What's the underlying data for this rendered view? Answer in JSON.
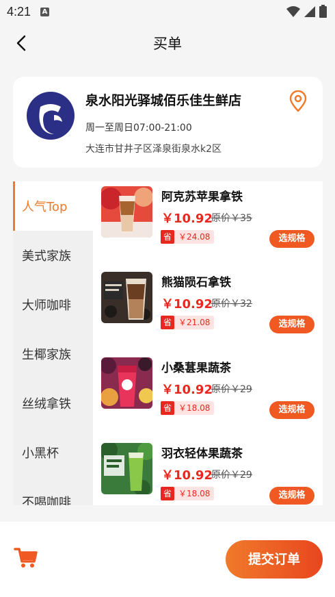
{
  "status_bar": {
    "time": "4:21",
    "notification_icon": "A"
  },
  "nav": {
    "title": "买单"
  },
  "store": {
    "name": "泉水阳光驿城佰乐佳生鲜店",
    "hours": "周一至周日07:00-21:00",
    "address": "大连市甘井子区泽泉街泉水k2区"
  },
  "categories": [
    {
      "label": "人气Top",
      "active": true
    },
    {
      "label": "美式家族"
    },
    {
      "label": "大师咖啡"
    },
    {
      "label": "生椰家族"
    },
    {
      "label": "丝绒拿铁"
    },
    {
      "label": "小黑杯"
    },
    {
      "label": "不喝咖啡"
    }
  ],
  "products": [
    {
      "name": "阿克苏苹果拿铁",
      "price": "￥10.92",
      "original": "原价￥35",
      "save_tag": "省",
      "save_amount": "￥24.08",
      "button": "选规格"
    },
    {
      "name": "熊猫陨石拿铁",
      "price": "￥10.92",
      "original": "原价￥32",
      "save_tag": "省",
      "save_amount": "￥21.08",
      "button": "选规格"
    },
    {
      "name": "小桑葚果蔬茶",
      "price": "￥10.92",
      "original": "原价￥29",
      "save_tag": "省",
      "save_amount": "￥18.08",
      "button": "选规格"
    },
    {
      "name": "羽衣轻体果蔬茶",
      "price": "￥10.92",
      "original": "原价￥29",
      "save_tag": "省",
      "save_amount": "￥18.08",
      "button": "选规格"
    }
  ],
  "bottom": {
    "submit_label": "提交订单"
  },
  "colors": {
    "accent": "#f07a2a",
    "price_red": "#e8281e",
    "button_orange": "#f05a22"
  }
}
